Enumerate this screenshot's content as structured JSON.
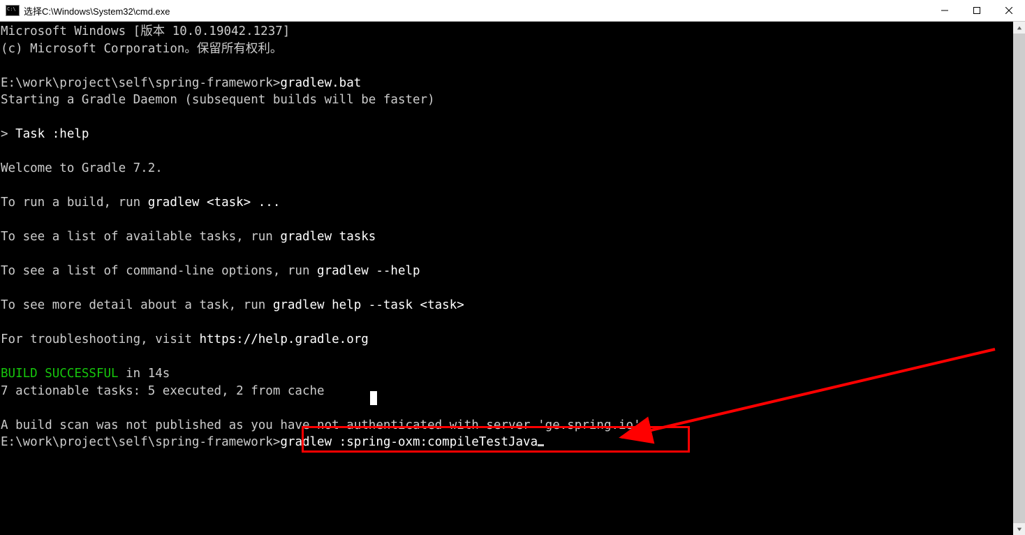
{
  "window": {
    "title": "选择C:\\Windows\\System32\\cmd.exe"
  },
  "terminal": {
    "line01a": "Microsoft Windows [",
    "line01b": "版本",
    "line01c": " 10.0.19042.1237]",
    "line02a": "(c) Microsoft Corporation",
    "line02b": "。保留所有权利。",
    "blank": "",
    "line03a": "E:\\work\\project\\self\\spring-framework>",
    "line03b": "gradlew.bat",
    "line04": "Starting a Gradle Daemon (subsequent builds will be faster)",
    "line05a": "> ",
    "line05b": "Task :help",
    "line06": "Welcome to Gradle 7.2.",
    "line07a": "To run a build, run ",
    "line07b": "gradlew <task> ...",
    "line08a": "To see a list of available tasks, run ",
    "line08b": "gradlew tasks",
    "line09a": "To see a list of command-line options, run ",
    "line09b": "gradlew --help",
    "line10a": "To see more detail about a task, run ",
    "line10b": "gradlew help --task <task>",
    "line11a": "For troubleshooting, visit ",
    "line11b": "https://help.gradle.org",
    "line12a": "BUILD SUCCESSFUL",
    "line12b": " in 14s",
    "line13": "7 actionable tasks: 5 executed, 2 from cache",
    "line14": "A build scan was not published as you have not authenticated with server 'ge.spring.io'.",
    "line15a": "E:\\work\\project\\self\\spring-framework>",
    "line15b": "gradlew :spring-oxm:compileTestJava"
  }
}
